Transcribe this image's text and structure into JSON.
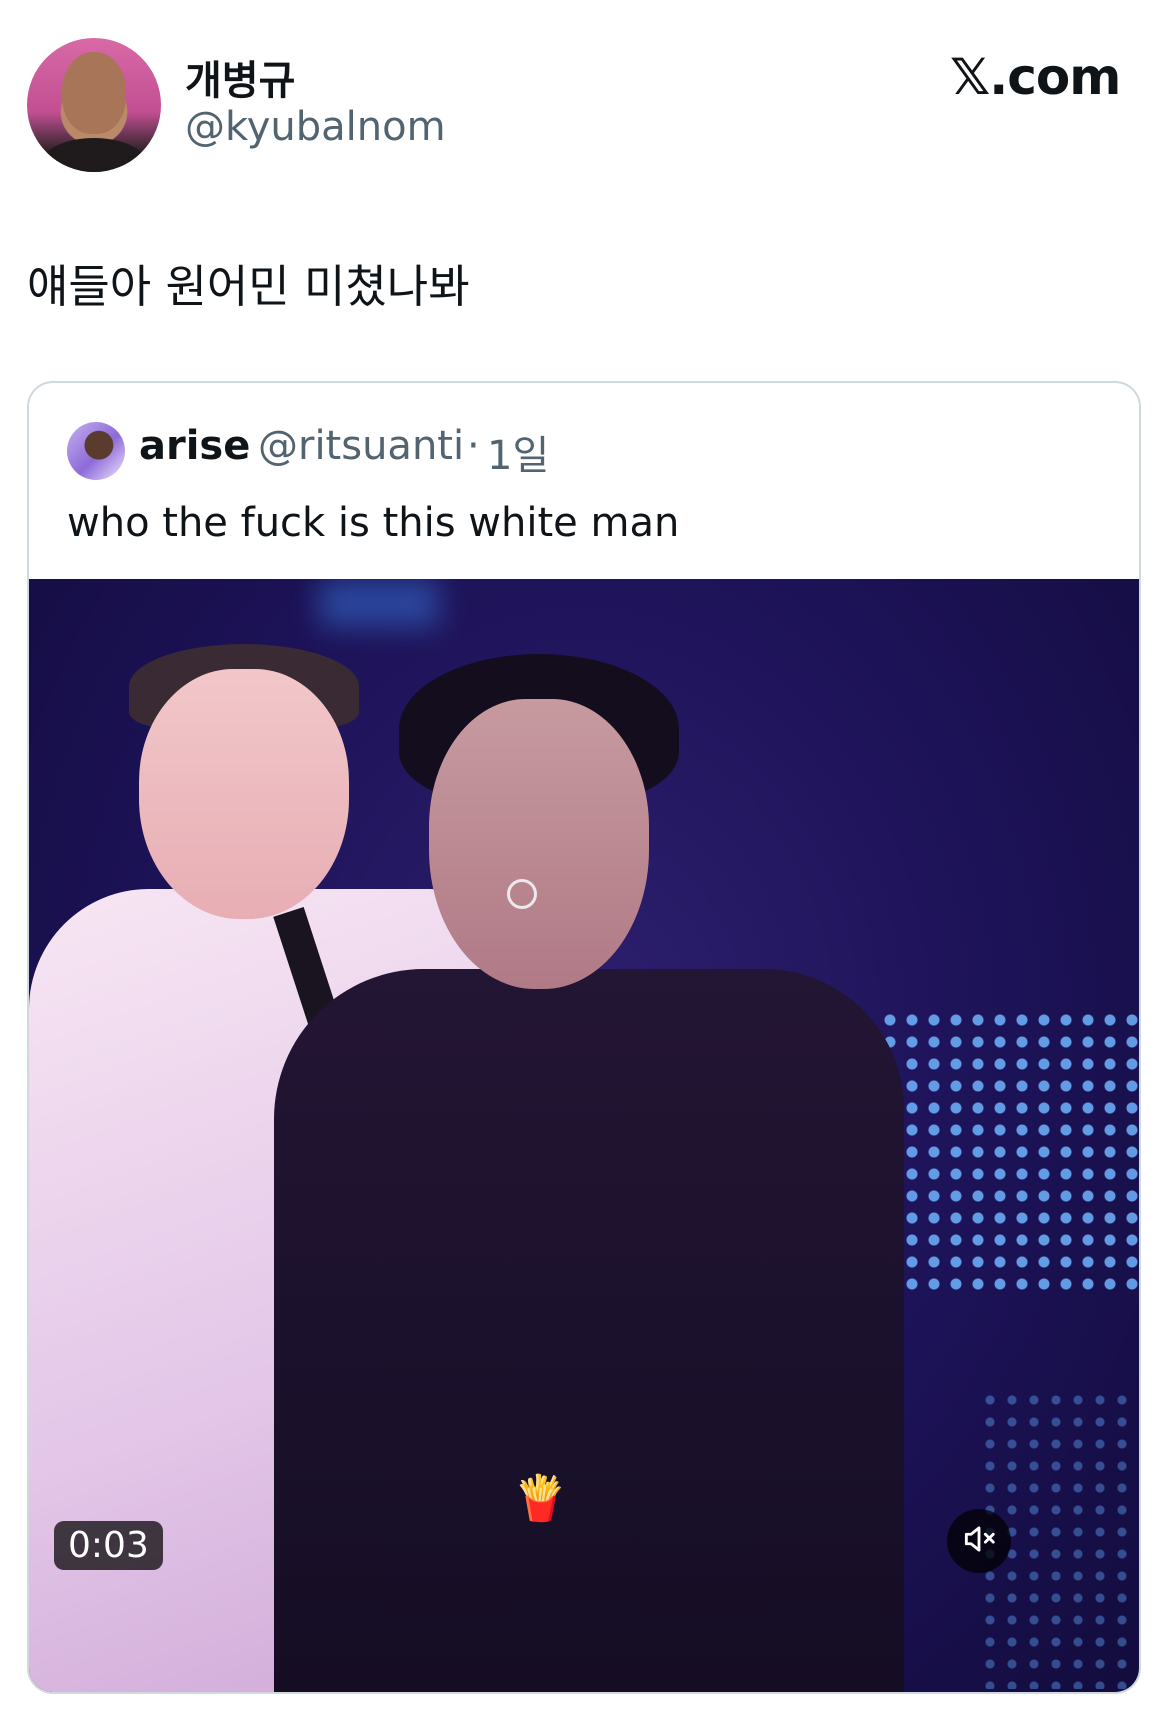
{
  "tweet": {
    "author": {
      "display_name": "개병규",
      "handle": "@kyubalnom"
    },
    "brand": "𝕏.com",
    "text": "얘들아 원어민 미쳤나봐"
  },
  "quoted_tweet": {
    "author": {
      "display_name": "arise",
      "handle": "@ritsuanti"
    },
    "separator": "·",
    "time": "1일",
    "text": "who the fuck is this white man",
    "media": {
      "type": "video",
      "timestamp": "0:03",
      "sticker": "🍟",
      "muted": true
    }
  },
  "icons": [
    "speaker-muted-icon"
  ]
}
